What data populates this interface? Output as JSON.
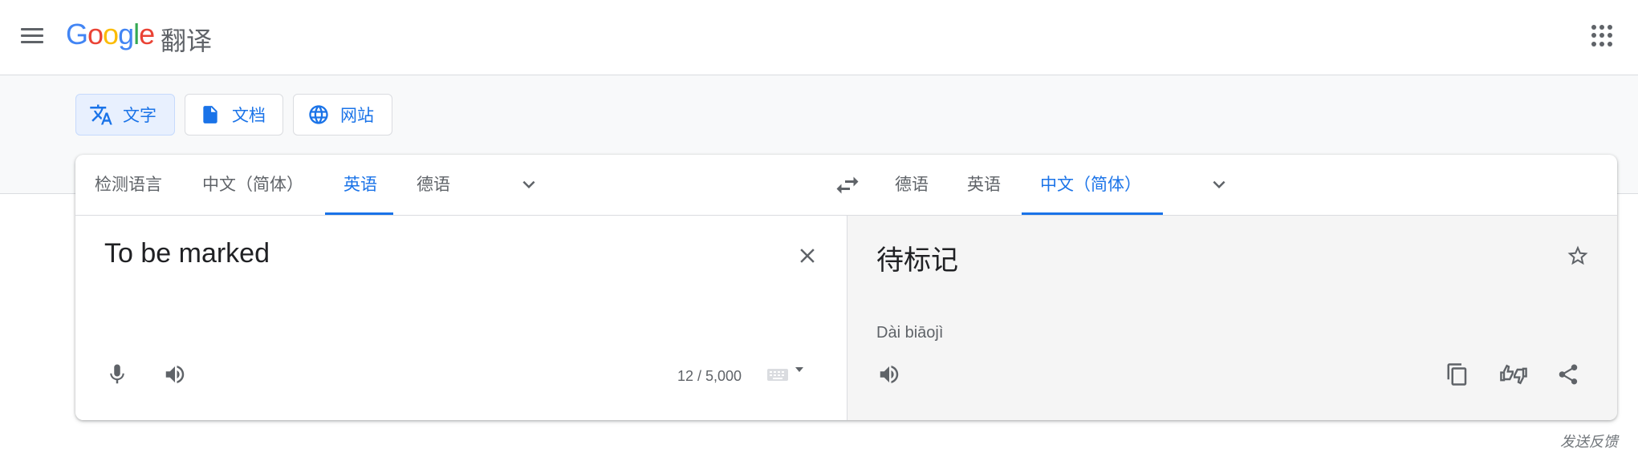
{
  "header": {
    "logo_letters": [
      "G",
      "o",
      "o",
      "g",
      "l",
      "e"
    ],
    "app_name": "翻译"
  },
  "modes": [
    {
      "label": "文字",
      "icon": "translate-icon",
      "active": true
    },
    {
      "label": "文档",
      "icon": "document-icon",
      "active": false
    },
    {
      "label": "网站",
      "icon": "globe-icon",
      "active": false
    }
  ],
  "source_langs": {
    "items": [
      "检测语言",
      "中文（简体）",
      "英语",
      "德语"
    ],
    "active_index": 2
  },
  "target_langs": {
    "items": [
      "德语",
      "英语",
      "中文（简体）"
    ],
    "active_index": 2
  },
  "source": {
    "text": "To be marked",
    "char_count": "12 / 5,000"
  },
  "target": {
    "text": "待标记",
    "pinyin": "Dài biāojì"
  },
  "footer": {
    "feedback": "发送反馈"
  },
  "colors": {
    "accent": "#1a73e8",
    "icon_gray": "#5f6368"
  }
}
